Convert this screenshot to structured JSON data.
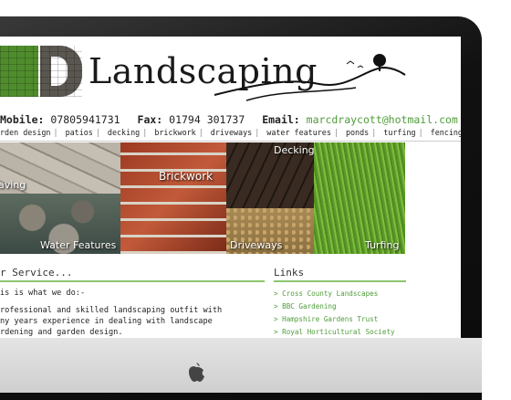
{
  "logo": {
    "mark": "MD",
    "name": "Landscaping"
  },
  "contact": {
    "mobile_label": "Mobile:",
    "mobile": "07805941731",
    "fax_label": "Fax:",
    "fax": "01794 301737",
    "email_label": "Email:",
    "email": "marcdraycott@hotmail.com"
  },
  "nav": [
    "rden design",
    "patios",
    "decking",
    "brickwork",
    "driveways",
    "water features",
    "ponds",
    "turfing",
    "fencing"
  ],
  "tiles": {
    "paving": "aving",
    "water": "Water Features",
    "brick": "Brickwork",
    "decking": "Decking",
    "driveways": "Driveways",
    "turfing": "Turfing"
  },
  "service": {
    "heading": "r Service...",
    "p1": "is is what we do:-",
    "p2a": "rofessional and skilled landscaping outfit with",
    "p2b": "ny years experience in dealing with landscape",
    "p2c": "rdening and garden design."
  },
  "links": {
    "heading": "Links",
    "items": [
      "> Cross County Landscapes",
      "> BBC Gardening",
      "> Hampshire Gardens Trust",
      "> Royal Horticultural Society"
    ]
  },
  "colors": {
    "accent": "#4f9c3a",
    "rule": "#8cc66b",
    "bezel": "#111111"
  },
  "icons": {
    "apple": "apple-logo-icon"
  }
}
